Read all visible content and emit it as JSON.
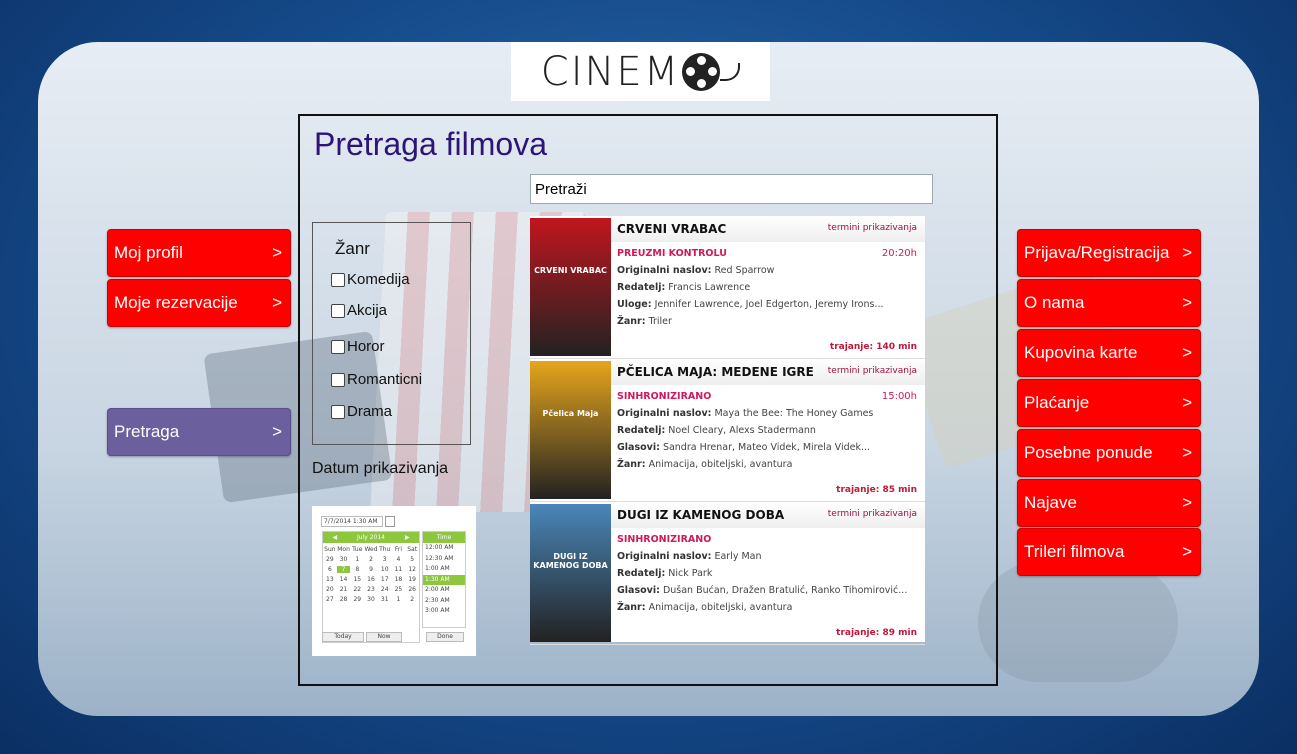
{
  "logo": {
    "text": "CINEM"
  },
  "page": {
    "title": "Pretraga filmova",
    "search_placeholder": "Pretraži"
  },
  "left_menu": [
    {
      "label": "Moj profil",
      "arrow": ">"
    },
    {
      "label": "Moje rezervacije",
      "arrow": ">"
    },
    {
      "label": "Pretraga",
      "arrow": ">",
      "active": true
    }
  ],
  "right_menu": [
    {
      "label": "Prijava/Registracija",
      "arrow": ">"
    },
    {
      "label": "O nama",
      "arrow": ">"
    },
    {
      "label": "Kupovina karte",
      "arrow": ">"
    },
    {
      "label": "Plaćanje",
      "arrow": ">"
    },
    {
      "label": "Posebne ponude",
      "arrow": ">"
    },
    {
      "label": "Najave",
      "arrow": ">"
    },
    {
      "label": "Trileri filmova",
      "arrow": ">"
    }
  ],
  "filters": {
    "genre_title": "Žanr",
    "genres": [
      "Komedija",
      "Akcija",
      "Horor",
      "Romanticni",
      "Drama"
    ],
    "date_label": "Datum prikazivanja"
  },
  "datepicker": {
    "input_value": "7/7/2014 1:30 AM",
    "month_label": "July 2014",
    "time_header": "Time",
    "weekdays": [
      "Sun",
      "Mon",
      "Tue",
      "Wed",
      "Thu",
      "Fri",
      "Sat"
    ],
    "days": [
      "29",
      "30",
      "1",
      "2",
      "3",
      "4",
      "5",
      "6",
      "7",
      "8",
      "9",
      "10",
      "11",
      "12",
      "13",
      "14",
      "15",
      "16",
      "17",
      "18",
      "19",
      "20",
      "21",
      "22",
      "23",
      "24",
      "25",
      "26",
      "27",
      "28",
      "29",
      "30",
      "31",
      "1",
      "2"
    ],
    "selected_day": "7",
    "times": [
      "12:00 AM",
      "12:30 AM",
      "1:00 AM",
      "1:30 AM",
      "2:00 AM",
      "2:30 AM",
      "3:00 AM"
    ],
    "selected_time": "1:30 AM",
    "today_label": "Today",
    "now_label": "Now",
    "done_label": "Done"
  },
  "movies": [
    {
      "title": "CRVENI VRABAC",
      "link": "termini prikazivanja",
      "tag": "PREUZMI KONTROLU",
      "time": "20:20h",
      "original_label": "Originalni naslov:",
      "original": "Red Sparrow",
      "director_label": "Redatelj:",
      "director": "Francis Lawrence",
      "cast_label": "Uloge:",
      "cast": "Jennifer Lawrence, Joel Edgerton, Jeremy Irons...",
      "genre_label": "Žanr:",
      "genre": "Triler",
      "duration": "trajanje: 140 min",
      "poster_color": "#c0161e",
      "poster_text": "CRVENI VRABAC"
    },
    {
      "title": "PČELICA MAJA: MEDENE IGRE",
      "link": "termini prikazivanja",
      "tag": "SINHRONIZIRANO",
      "time": "15:00h",
      "original_label": "Originalni naslov:",
      "original": "Maya the Bee: The Honey Games",
      "director_label": "Redatelj:",
      "director": "Noel Cleary, Alexs Stadermann",
      "cast_label": "Glasovi:",
      "cast": "Sandra Hrenar, Mateo Videk, Mirela Videk...",
      "genre_label": "Žanr:",
      "genre": "Animacija, obiteljski, avantura",
      "duration": "trajanje: 85 min",
      "poster_color": "#e6a51c",
      "poster_text": "Pčelica Maja"
    },
    {
      "title": "DUGI IZ KAMENOG DOBA",
      "link": "termini prikazivanja",
      "tag": "SINHRONIZIRANO",
      "time": "",
      "original_label": "Originalni naslov:",
      "original": "Early Man",
      "director_label": "Redatelj:",
      "director": "Nick Park",
      "cast_label": "Glasovi:",
      "cast": "Dušan Bućan, Dražen Bratulić, Ranko Tihomirović...",
      "genre_label": "Žanr:",
      "genre": "Animacija, obiteljski, avantura",
      "duration": "trajanje: 89 min",
      "poster_color": "#4a86b8",
      "poster_text": "DUGI IZ KAMENOG DOBA"
    }
  ]
}
